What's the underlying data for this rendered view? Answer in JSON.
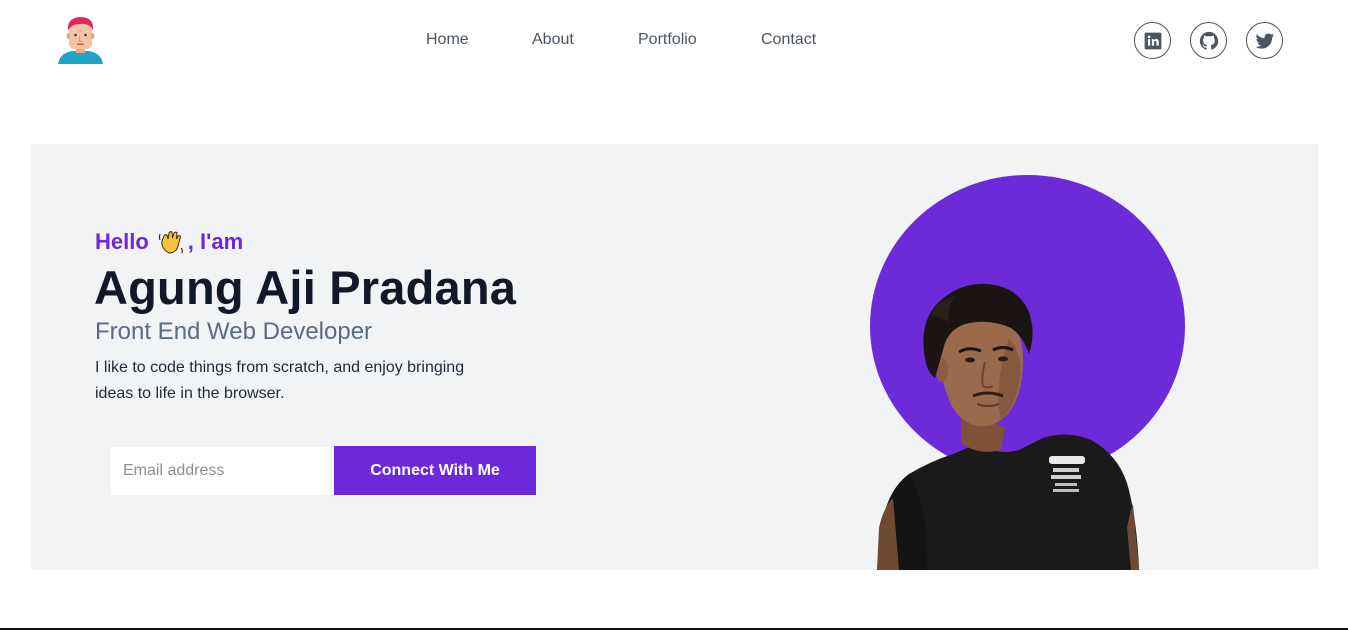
{
  "header": {
    "logo_icon": "avatar-logo-icon",
    "nav": {
      "home": "Home",
      "about": "About",
      "portfolio": "Portfolio",
      "contact": "Contact"
    },
    "social": [
      {
        "name": "linkedin",
        "icon": "linkedin-icon"
      },
      {
        "name": "github",
        "icon": "github-icon"
      },
      {
        "name": "twitter",
        "icon": "twitter-icon"
      }
    ]
  },
  "hero": {
    "greeting_prefix": "Hello",
    "greeting_suffix": ", I'am",
    "wave_icon": "waving-hand-icon",
    "name": "Agung Aji Pradana",
    "role": "Front End Web Developer",
    "description": "I like to code things from scratch, and enjoy bringing ideas to life in the browser.",
    "email_placeholder": "Email address",
    "email_value": "",
    "connect_button": "Connect With Me"
  },
  "colors": {
    "accent": "#6d28d9",
    "hero_bg": "#f2f3f5",
    "text_dark": "#111827",
    "text_muted": "#5b6b82",
    "nav_text": "#4b5563"
  }
}
